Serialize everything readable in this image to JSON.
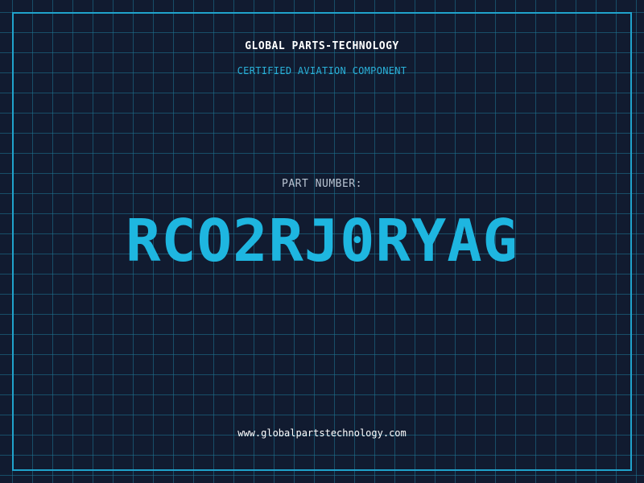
{
  "header": {
    "company": "GLOBAL PARTS-TECHNOLOGY",
    "subtitle": "CERTIFIED AVIATION COMPONENT"
  },
  "part": {
    "label": "PART NUMBER:",
    "number": "RCO2RJ0RYAG"
  },
  "footer": {
    "website": "www.globalpartstechnology.com"
  },
  "colors": {
    "background": "#111b30",
    "accent": "#1eb6e0",
    "grid": "#1e7896",
    "frame": "#20a3cc"
  }
}
